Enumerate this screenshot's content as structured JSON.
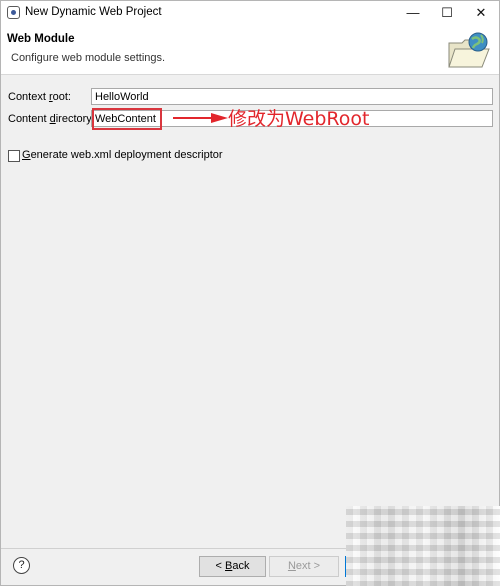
{
  "window": {
    "title": "New Dynamic Web Project",
    "controls": {
      "minimize": "—",
      "maximize": "☐",
      "close": "✕"
    }
  },
  "header": {
    "title": "Web Module",
    "description": "Configure web module settings.",
    "icon": "wizard-folder-globe-icon"
  },
  "form": {
    "context_root": {
      "label_pre": "Context ",
      "label_mnemonic": "r",
      "label_post": "oot:",
      "value": "HelloWorld"
    },
    "content_directory": {
      "label_pre": "Content ",
      "label_mnemonic": "d",
      "label_post": "irectory:",
      "value": "WebContent"
    },
    "generate_descriptor": {
      "label_mnemonic": "G",
      "label_post": "enerate web.xml deployment descriptor",
      "checked": false
    }
  },
  "annotation": {
    "text": "修改为WebRoot",
    "color": "#e2262c"
  },
  "footer": {
    "help": "?",
    "back": {
      "pre": "< ",
      "mnemonic": "B",
      "post": "ack"
    },
    "next": {
      "mnemonic": "N",
      "post": "ext >"
    }
  }
}
